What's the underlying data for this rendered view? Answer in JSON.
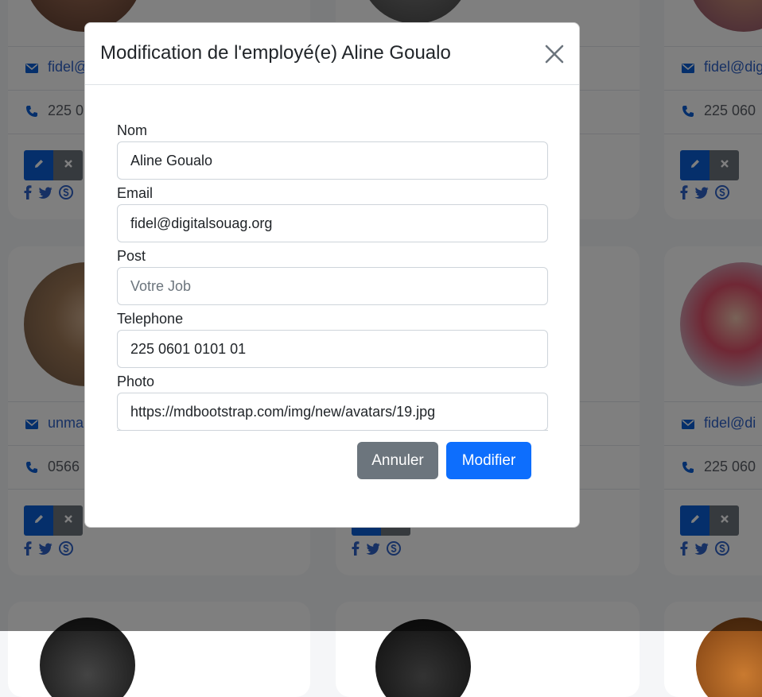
{
  "modal": {
    "title": "Modification de l'employé(e) Aline Goualo",
    "fields": [
      {
        "label": "Nom",
        "value": "Aline Goualo",
        "placeholder": ""
      },
      {
        "label": "Email",
        "value": "fidel@digitalsouag.org",
        "placeholder": ""
      },
      {
        "label": "Post",
        "value": "",
        "placeholder": "Votre Job"
      },
      {
        "label": "Telephone",
        "value": "225 0601 0101 01",
        "placeholder": ""
      },
      {
        "label": "Photo",
        "value": "https://mdbootstrap.com/img/new/avatars/19.jpg",
        "placeholder": ""
      }
    ],
    "cancel_label": "Annuler",
    "submit_label": "Modifier"
  },
  "background": {
    "cards": [
      {
        "email": "fidel@",
        "phone": "225 0"
      },
      {
        "email": "fidel@digi",
        "phone": "225 060"
      },
      {
        "email": "unma",
        "phone": "0566"
      },
      {
        "email": "fidel@di",
        "phone": "225 060"
      }
    ]
  },
  "colors": {
    "primary": "#0d6efd",
    "secondary": "#6c757d",
    "link": "#2f62c9",
    "backdrop": "rgba(0,0,0,0.5)"
  },
  "icons": [
    "envelope-icon",
    "phone-icon",
    "pencil-icon",
    "x-icon",
    "facebook-icon",
    "twitter-icon",
    "skype-icon",
    "close-icon"
  ]
}
